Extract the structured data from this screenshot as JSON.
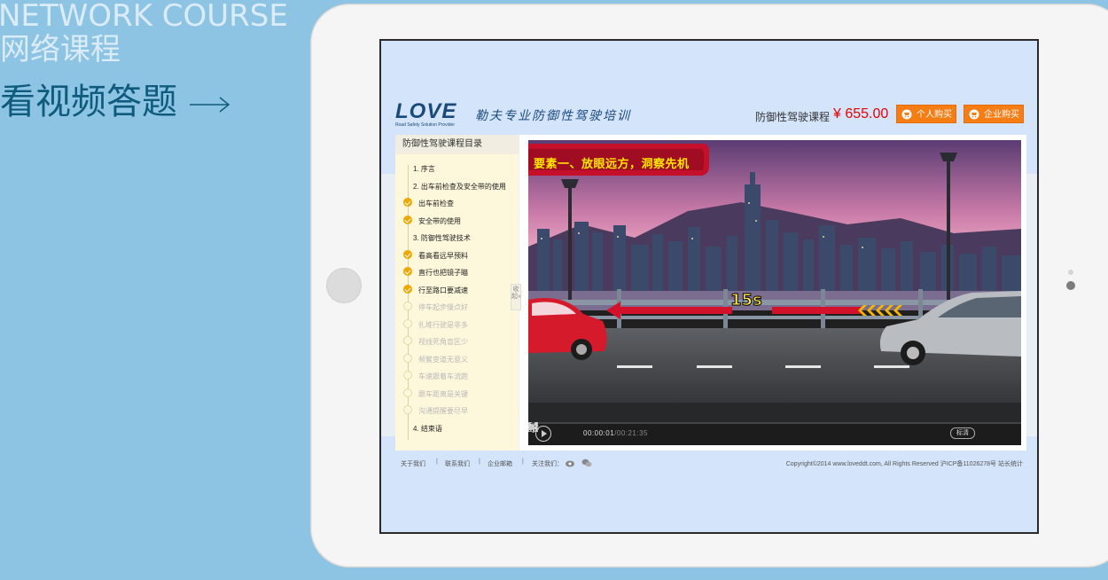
{
  "promo": {
    "title_en": "NETWORK COURSE",
    "title_cn": "网络课程",
    "cta": "看视频答题"
  },
  "site": {
    "logo": "LOVE",
    "logo_sub": "Road Safety Solution Provider",
    "slogan": "勒夫专业防御性驾驶培训",
    "course_name": "防御性驾驶课程",
    "price": "¥ 655.00",
    "buy_personal": "个人购买",
    "buy_company": "企业购买"
  },
  "toc": {
    "title": "防御性驾驶课程目录",
    "collapse": "收起«",
    "items": [
      {
        "label": "1. 序言",
        "type": "section"
      },
      {
        "label": "2. 出车前检查及安全带的使用",
        "type": "section"
      },
      {
        "label": "出车前检查",
        "type": "done"
      },
      {
        "label": "安全带的使用",
        "type": "done"
      },
      {
        "label": "3. 防御性驾驶技术",
        "type": "section"
      },
      {
        "label": "看高看远早预料",
        "type": "done"
      },
      {
        "label": "直行也把镜子瞄",
        "type": "done"
      },
      {
        "label": "行至路口要减速",
        "type": "done"
      },
      {
        "label": "停车起步慢点好",
        "type": "todo"
      },
      {
        "label": "扎堆行驶是非多",
        "type": "todo"
      },
      {
        "label": "视线死角盲区少",
        "type": "todo"
      },
      {
        "label": "频繁变道无意义",
        "type": "todo"
      },
      {
        "label": "车速跟着车流跑",
        "type": "todo"
      },
      {
        "label": "跟车距离是关键",
        "type": "todo"
      },
      {
        "label": "沟通提醒要尽早",
        "type": "todo"
      },
      {
        "label": "4. 结束语",
        "type": "section"
      }
    ]
  },
  "video": {
    "caption": "要素一、放眼远方，洞察先机",
    "countdown": "15s",
    "current_time": "00:00:01",
    "total_time": "/00:21:35",
    "cc_label": "标清",
    "progress": 0.005
  },
  "footer": {
    "links": [
      "关于我们",
      "联系我们",
      "企业邮箱",
      "关注我们："
    ],
    "copyright": "Copyright©2014 www.loveddt.com, All Rights Reserved 沪ICP备11026278号   站长统计"
  }
}
